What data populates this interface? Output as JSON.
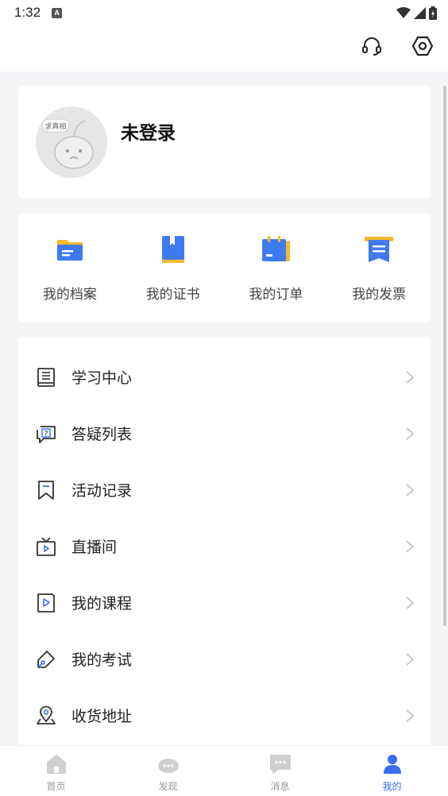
{
  "status_bar": {
    "time": "1:32",
    "notif_letter": "A"
  },
  "profile": {
    "name": "未登录",
    "avatar_badge": "求真相"
  },
  "quick_actions": [
    {
      "label": "我的档案",
      "icon": "folder-icon"
    },
    {
      "label": "我的证书",
      "icon": "book-icon"
    },
    {
      "label": "我的订单",
      "icon": "calendar-icon"
    },
    {
      "label": "我的发票",
      "icon": "receipt-icon"
    }
  ],
  "menu": [
    {
      "label": "学习中心",
      "icon": "study-icon"
    },
    {
      "label": "答疑列表",
      "icon": "question-chat-icon"
    },
    {
      "label": "活动记录",
      "icon": "bookmark-icon"
    },
    {
      "label": "直播间",
      "icon": "tv-icon"
    },
    {
      "label": "我的课程",
      "icon": "course-play-icon"
    },
    {
      "label": "我的考试",
      "icon": "pen-icon"
    },
    {
      "label": "收货地址",
      "icon": "location-icon"
    }
  ],
  "tabs": [
    {
      "label": "首页",
      "icon": "home-icon"
    },
    {
      "label": "发现",
      "icon": "discover-icon"
    },
    {
      "label": "消息",
      "icon": "message-icon"
    },
    {
      "label": "我的",
      "icon": "user-icon",
      "active": true
    }
  ],
  "colors": {
    "accent": "#3a6ef0",
    "folder_blue": "#3f7bf0",
    "yellow": "#f5b82e"
  }
}
